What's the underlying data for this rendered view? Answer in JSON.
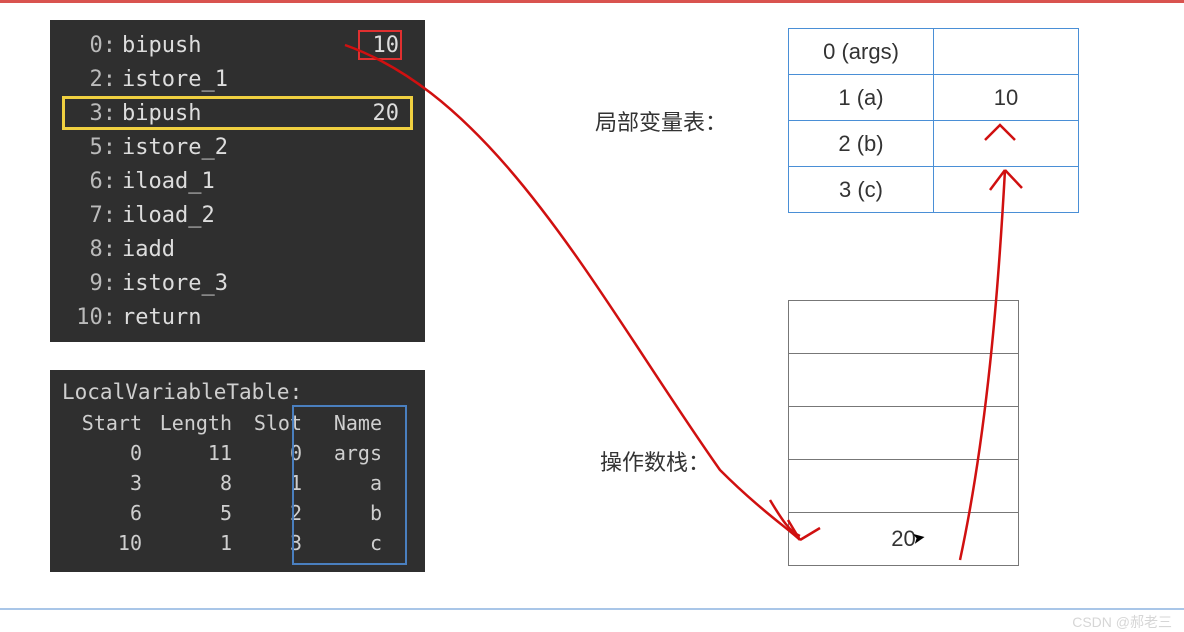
{
  "bytecode": {
    "lines": [
      {
        "offset": "0:",
        "instr": "bipush",
        "oper": "10",
        "red_box": true
      },
      {
        "offset": "2:",
        "instr": "istore_1",
        "oper": ""
      },
      {
        "offset": "3:",
        "instr": "bipush",
        "oper": "20",
        "highlight": "yellow"
      },
      {
        "offset": "5:",
        "instr": "istore_2",
        "oper": ""
      },
      {
        "offset": "6:",
        "instr": "iload_1",
        "oper": ""
      },
      {
        "offset": "7:",
        "instr": "iload_2",
        "oper": ""
      },
      {
        "offset": "8:",
        "instr": "iadd",
        "oper": ""
      },
      {
        "offset": "9:",
        "instr": "istore_3",
        "oper": ""
      },
      {
        "offset": "10:",
        "instr": "return",
        "oper": ""
      }
    ]
  },
  "lvt": {
    "title": "LocalVariableTable:",
    "headers": {
      "start": "Start",
      "length": "Length",
      "slot": "Slot",
      "name": "Name"
    },
    "rows": [
      {
        "start": "0",
        "length": "11",
        "slot": "0",
        "name": "args"
      },
      {
        "start": "3",
        "length": "8",
        "slot": "1",
        "name": "a"
      },
      {
        "start": "6",
        "length": "5",
        "slot": "2",
        "name": "b"
      },
      {
        "start": "10",
        "length": "1",
        "slot": "3",
        "name": "c"
      }
    ]
  },
  "local_var_table": {
    "label": "局部变量表：",
    "rows": [
      {
        "slot": "0 (args)",
        "value": ""
      },
      {
        "slot": "1 (a)",
        "value": "10"
      },
      {
        "slot": "2 (b)",
        "value": ""
      },
      {
        "slot": "3 (c)",
        "value": ""
      }
    ]
  },
  "operand_stack": {
    "label": "操作数栈：",
    "cells": [
      "",
      "",
      "",
      "",
      "20"
    ]
  },
  "watermark": "CSDN @郝老三",
  "chart_data": {
    "type": "table",
    "title": "JVM bytecode execution snapshot — bipush 20",
    "bytecode": [
      {
        "pc": 0,
        "op": "bipush",
        "arg": 10
      },
      {
        "pc": 2,
        "op": "istore_1"
      },
      {
        "pc": 3,
        "op": "bipush",
        "arg": 20,
        "current": true
      },
      {
        "pc": 5,
        "op": "istore_2"
      },
      {
        "pc": 6,
        "op": "iload_1"
      },
      {
        "pc": 7,
        "op": "iload_2"
      },
      {
        "pc": 8,
        "op": "iadd"
      },
      {
        "pc": 9,
        "op": "istore_3"
      },
      {
        "pc": 10,
        "op": "return"
      }
    ],
    "local_variable_table_meta": [
      {
        "start": 0,
        "length": 11,
        "slot": 0,
        "name": "args"
      },
      {
        "start": 3,
        "length": 8,
        "slot": 1,
        "name": "a"
      },
      {
        "start": 6,
        "length": 5,
        "slot": 2,
        "name": "b"
      },
      {
        "start": 10,
        "length": 1,
        "slot": 3,
        "name": "c"
      }
    ],
    "locals": {
      "0": "args",
      "1": 10,
      "2": null,
      "3": null
    },
    "stack_top_to_bottom": [
      20
    ],
    "annotations": [
      "arrow from bytecode operand 10 (pc 0) to operand-stack area then into local slot 1 (value 10)",
      "red box around operand 10; yellow highlight on line pc 3 (bipush 20)"
    ]
  }
}
